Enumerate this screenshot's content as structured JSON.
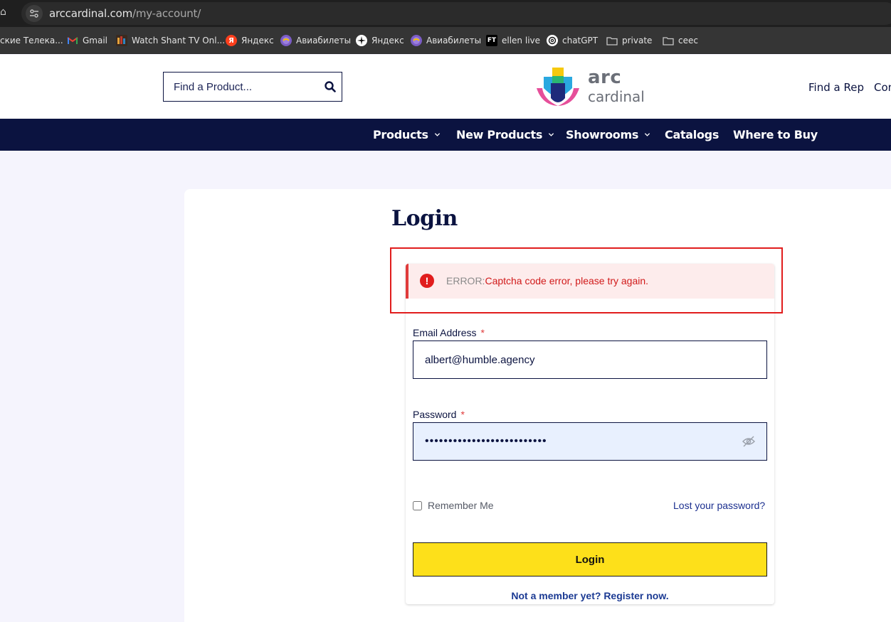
{
  "browser": {
    "url_host": "arccardinal.com",
    "url_path": "/my-account/",
    "bookmarks": [
      {
        "label": "ские Телека...",
        "icon": "none"
      },
      {
        "label": "Gmail",
        "icon": "gmail-icon"
      },
      {
        "label": "Watch Shant TV Onl...",
        "icon": "shant-tv-icon"
      },
      {
        "label": "Яндекс",
        "icon": "yandex-icon"
      },
      {
        "label": "Авиабилеты",
        "icon": "aviasales-icon"
      },
      {
        "label": "Яндекс",
        "icon": "sparkle-icon"
      },
      {
        "label": "Авиабилеты",
        "icon": "aviasales-icon"
      },
      {
        "label": "ellen live",
        "icon": "ft-icon"
      },
      {
        "label": "chatGPT",
        "icon": "openai-icon"
      },
      {
        "label": "private",
        "icon": "folder-icon"
      },
      {
        "label": "ceec",
        "icon": "folder-icon"
      }
    ],
    "yandex_glyph": "Я",
    "ft_glyph": "FT"
  },
  "header": {
    "search_placeholder": "Find a Product...",
    "logo_line1": "arc",
    "logo_line2": "cardinal",
    "links": [
      "Find a Rep",
      "Con"
    ]
  },
  "nav": {
    "items": [
      {
        "label": "Products",
        "has_dropdown": true
      },
      {
        "label": "New Products",
        "has_dropdown": true
      },
      {
        "label": "Showrooms",
        "has_dropdown": true
      },
      {
        "label": "Catalogs",
        "has_dropdown": false
      },
      {
        "label": "Where to Buy",
        "has_dropdown": false
      }
    ]
  },
  "login": {
    "title": "Login",
    "error_icon": "!",
    "error_label": "ERROR:",
    "error_message": "Captcha code error, please try again.",
    "email_label": "Email Address",
    "email_value": "albert@humble.agency",
    "password_label": "Password",
    "password_value": "••••••••••••••••••••••••••",
    "required_mark": "*",
    "remember_label": "Remember Me",
    "remember_checked": false,
    "lost_password": "Lost your password?",
    "submit_label": "Login",
    "register_text": "Not a member yet? Register now."
  },
  "colors": {
    "navy": "#0b1340",
    "login_button": "#fde01a",
    "error_red": "#d11a1a",
    "error_bg": "#fdecec",
    "page_bg": "#f5f4fd"
  }
}
